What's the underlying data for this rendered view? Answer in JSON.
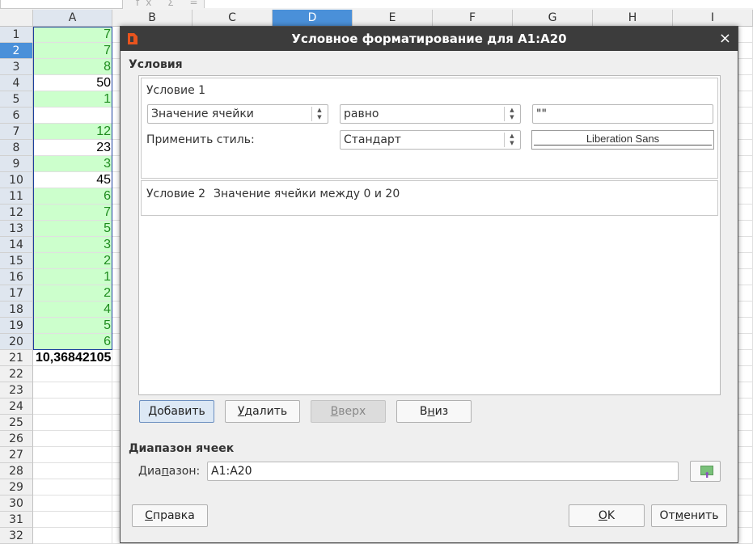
{
  "spreadsheet": {
    "formula_bar": {
      "fx": "fx Σ ="
    },
    "columns": [
      {
        "id": "A",
        "label": "A"
      },
      {
        "id": "B",
        "label": "B"
      },
      {
        "id": "C",
        "label": "C"
      },
      {
        "id": "D",
        "label": "D"
      },
      {
        "id": "E",
        "label": "E"
      },
      {
        "id": "F",
        "label": "F"
      },
      {
        "id": "G",
        "label": "G"
      },
      {
        "id": "H",
        "label": "H"
      },
      {
        "id": "I",
        "label": "I"
      }
    ],
    "active_column": "D",
    "rows": [
      {
        "n": "1",
        "a": "7",
        "green": true
      },
      {
        "n": "2",
        "a": "7",
        "green": true
      },
      {
        "n": "3",
        "a": "8",
        "green": true
      },
      {
        "n": "4",
        "a": "50",
        "green": false
      },
      {
        "n": "5",
        "a": "1",
        "green": true
      },
      {
        "n": "6",
        "a": "",
        "green": false
      },
      {
        "n": "7",
        "a": "12",
        "green": true
      },
      {
        "n": "8",
        "a": "23",
        "green": false
      },
      {
        "n": "9",
        "a": "3",
        "green": true
      },
      {
        "n": "10",
        "a": "45",
        "green": false
      },
      {
        "n": "11",
        "a": "6",
        "green": true
      },
      {
        "n": "12",
        "a": "7",
        "green": true
      },
      {
        "n": "13",
        "a": "5",
        "green": true
      },
      {
        "n": "14",
        "a": "3",
        "green": true
      },
      {
        "n": "15",
        "a": "2",
        "green": true
      },
      {
        "n": "16",
        "a": "1",
        "green": true
      },
      {
        "n": "17",
        "a": "2",
        "green": true
      },
      {
        "n": "18",
        "a": "4",
        "green": true
      },
      {
        "n": "19",
        "a": "5",
        "green": true
      },
      {
        "n": "20",
        "a": "6",
        "green": true
      },
      {
        "n": "21",
        "a": "10,36842105",
        "bold": true
      },
      {
        "n": "22",
        "a": ""
      },
      {
        "n": "23",
        "a": ""
      },
      {
        "n": "24",
        "a": ""
      },
      {
        "n": "25",
        "a": ""
      },
      {
        "n": "26",
        "a": ""
      },
      {
        "n": "27",
        "a": ""
      },
      {
        "n": "28",
        "a": ""
      },
      {
        "n": "29",
        "a": ""
      },
      {
        "n": "30",
        "a": ""
      },
      {
        "n": "31",
        "a": ""
      },
      {
        "n": "32",
        "a": ""
      }
    ],
    "active_row": "2",
    "colors": {
      "green_fill": "#ccffcc",
      "green_text": "#1e8c1e",
      "selection_border": "#1b3f9e",
      "active_header": "#4a90d9"
    }
  },
  "dialog": {
    "title": "Условное форматирование для A1:A20",
    "close_glyph": "×",
    "conditions_title": "Условия",
    "condition1": {
      "label": "Условие 1",
      "type_value": "Значение ячейки",
      "operator_value": "равно",
      "value_field": "\"\"",
      "apply_style_label": "Применить стиль:",
      "style_value": "Стандарт",
      "preview_text": "Liberation Sans"
    },
    "condition2": {
      "label": "Условие 2",
      "summary": "Значение ячейки между 0 и 20"
    },
    "buttons": {
      "add": {
        "pre": "",
        "ul": "Д",
        "post": "обавить"
      },
      "delete": {
        "pre": "",
        "ul": "У",
        "post": "далить"
      },
      "up": {
        "pre": "",
        "ul": "В",
        "post": "верх"
      },
      "down": {
        "pre": "В",
        "ul": "н",
        "post": "из"
      }
    },
    "range_section_title": "Диапазон ячеек",
    "range_label": {
      "pre": "Диа",
      "ul": "п",
      "post": "азон:"
    },
    "range_value": "A1:A20",
    "help": {
      "pre": "",
      "ul": "С",
      "post": "правка"
    },
    "ok": {
      "pre": "",
      "ul": "О",
      "post": "K"
    },
    "cancel": {
      "pre": "От",
      "ul": "м",
      "post": "енить"
    }
  }
}
